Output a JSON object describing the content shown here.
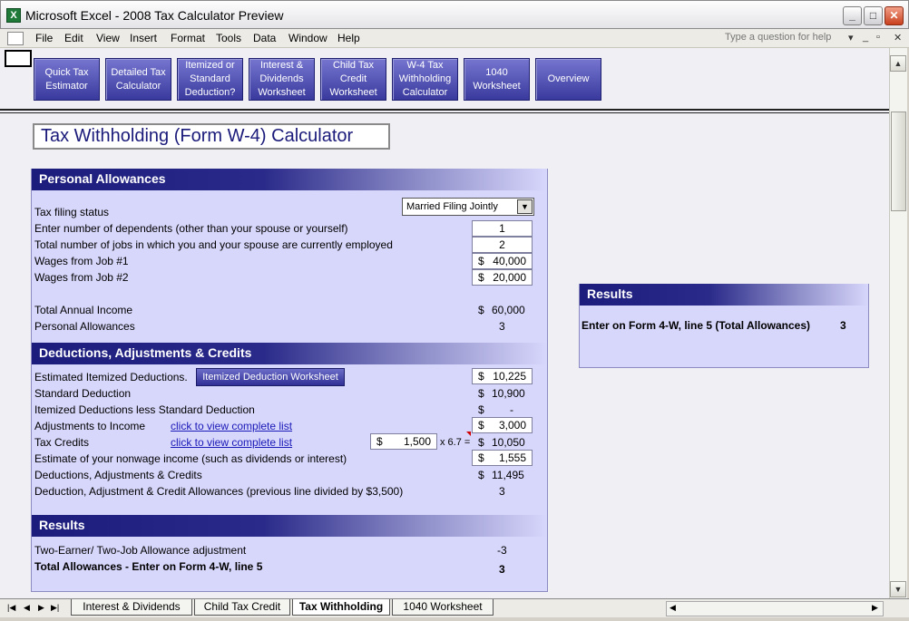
{
  "window": {
    "title": "Microsoft Excel - 2008 Tax Calculator Preview",
    "app_icon": "X"
  },
  "menu": {
    "items": [
      "File",
      "Edit",
      "View",
      "Insert",
      "Format",
      "Tools",
      "Data",
      "Window",
      "Help"
    ],
    "ask_placeholder": "Type a question for help"
  },
  "nav_buttons": [
    {
      "label": "Quick Tax Estimator"
    },
    {
      "label": "Detailed Tax Calculator"
    },
    {
      "label": "Itemized or Standard Deduction?"
    },
    {
      "label": "Interest & Dividends Worksheet"
    },
    {
      "label": "Child Tax Credit Worksheet"
    },
    {
      "label": "W-4 Tax Withholding Calculator"
    },
    {
      "label": "1040 Worksheet"
    },
    {
      "label": "Overview"
    }
  ],
  "page_title": "Tax Withholding (Form W-4) Calculator",
  "personal": {
    "header": "Personal Allowances",
    "filing_label": "Tax filing status",
    "filing_value": "Married Filing Jointly",
    "dependents_label": "Enter number of dependents (other than your spouse or yourself)",
    "dependents_value": "1",
    "jobs_label": "Total number of jobs in which you and your spouse are currently employed",
    "jobs_value": "2",
    "job1_label": "Wages from Job #1",
    "job1_value": "40,000",
    "job2_label": "Wages from Job #2",
    "job2_value": "20,000",
    "total_income_label": "Total Annual Income",
    "total_income_value": "60,000",
    "allowances_label": "Personal Allowances",
    "allowances_value": "3"
  },
  "deductions": {
    "header": "Deductions, Adjustments & Credits",
    "itemized_label": "Estimated Itemized Deductions.",
    "itemized_button": "Itemized Deduction Worksheet",
    "itemized_value": "10,225",
    "standard_label": "Standard Deduction",
    "standard_value": "10,900",
    "less_label": "Itemized Deductions less Standard Deduction",
    "less_value": "-",
    "adjust_label": "Adjustments to Income",
    "adjust_link": "click to view complete list",
    "adjust_value": "3,000",
    "credits_label": "Tax Credits",
    "credits_link": "click to view complete list",
    "credits_input": "1,500",
    "credits_multiplier": "x 6.7 =",
    "credits_value": "10,050",
    "nonwage_label": "Estimate of your nonwage income (such as dividends or interest)",
    "nonwage_value": "1,555",
    "total_label": "Deductions, Adjustments & Credits",
    "total_value": "11,495",
    "allow_label": "Deduction, Adjustment & Credit Allowances (previous line divided by $3,500)",
    "allow_value": "3"
  },
  "results": {
    "header": "Results",
    "twojob_label": "Two-Earner/ Two-Job Allowance adjustment",
    "twojob_value": "-3",
    "total_label": "Total Allowances - Enter on Form 4-W, line 5",
    "total_value": "3"
  },
  "side_results": {
    "header": "Results",
    "label": "Enter on Form 4-W, line 5 (Total Allowances)",
    "value": "3"
  },
  "currency": "$",
  "sheet_tabs": [
    "Interest & Dividends",
    "Child Tax Credit",
    "Tax Withholding",
    "1040 Worksheet"
  ],
  "active_tab": "Tax Withholding"
}
